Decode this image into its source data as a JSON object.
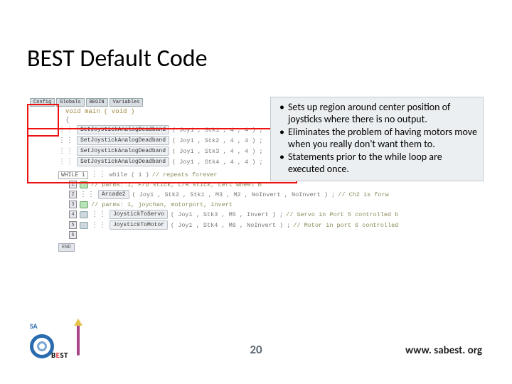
{
  "title": "BEST Default Code",
  "tabs": [
    "Config",
    "Globals",
    "BEGIN",
    "Variables"
  ],
  "main_decl": "void main ( void )",
  "brace_open": "{",
  "deadband": {
    "fn": "SetJoystickAnalogDeadband",
    "lines": [
      "( Joy1 , Stk1 , 4 , 4 ) ;",
      "( Joy1 , Stk2 , 4 , 4 ) ;",
      "( Joy1 , Stk3 , 4 , 4 ) ;",
      "( Joy1 , Stk4 , 4 , 4 ) ;"
    ]
  },
  "while": {
    "box": "WHILE 1",
    "cond": "while ( 1 ) ",
    "comment": "// repeats forever"
  },
  "rows": [
    {
      "num": "1",
      "fn": "",
      "args": "",
      "comment": "// parms: 1, F/D stick, L/R stick,  Left wheel m"
    },
    {
      "num": "2",
      "fn": "Arcade2",
      "args": "( Joy1 , Stk2 , Stk1 , M3 , M2 , NoInvert , NoInvert ) ;",
      "comment": "// Ch2 is forw"
    },
    {
      "num": "3",
      "fn": "",
      "args": "",
      "comment": "// parms: 1, joychan, motorport, invert"
    },
    {
      "num": "4",
      "fn": "JoystickToServo",
      "args": "( Joy1 , Stk3 , M5 , Invert ) ;",
      "comment": "// Servo in Port 5 controlled b"
    },
    {
      "num": "5",
      "fn": "JoystickToMotor",
      "args": "( Joy1 , Stk4 , M6 , NoInvert ) ;",
      "comment": "// Motor in port 6 controlled"
    },
    {
      "num": "6",
      "fn": "",
      "args": "",
      "comment": ""
    }
  ],
  "end_label": "END",
  "bullets": [
    "Sets up region around center position of joysticks where there is no output.",
    "Eliminates the problem of having motors move when you really don't want them to.",
    "Statements prior to the while loop are executed once."
  ],
  "page_number": "20",
  "footer_url": "www. sabest. org",
  "logo_text": {
    "sa": "SA",
    "b": "B",
    "e": "E",
    "st": "ST"
  }
}
